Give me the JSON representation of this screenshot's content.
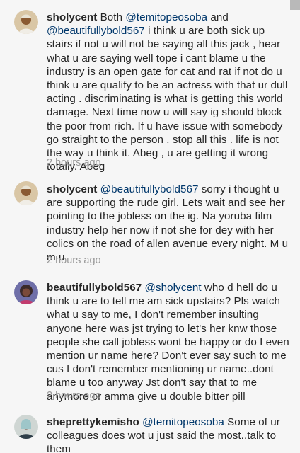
{
  "comments": [
    {
      "username": "sholycent",
      "avatar": "avatar-sholycent",
      "parts": [
        {
          "type": "text",
          "value": " Both "
        },
        {
          "type": "mention",
          "value": "@temitopeosoba"
        },
        {
          "type": "text",
          "value": "  and "
        },
        {
          "type": "mention",
          "value": "@beautifullybold567"
        },
        {
          "type": "text",
          "value": " i think u are both sick up stairs if not u will not be saying all this jack , hear what u are saying well tope i cant blame u the industry is an open gate for cat and rat if not do u think u are qualify to be an actress with that ur dull acting . discriminating is what is getting this world damage.  Next time now u will say ig should block the poor from rich. If u have issue with somebody go straight to the person . stop all this . life is not the way u think it. Abeg , u are getting it wrong totally. Abeg"
        }
      ],
      "time": "2 hours ago"
    },
    {
      "username": "sholycent",
      "avatar": "avatar-sholycent",
      "parts": [
        {
          "type": "text",
          "value": " "
        },
        {
          "type": "mention",
          "value": "@beautifullybold567"
        },
        {
          "type": "text",
          "value": " sorry i thought u are supporting the rude girl. Lets wait and see her pointing to the jobless on the ig. Na yoruba film industry help her now if not she for dey with her colics on the road of allen avenue every night. M u m u"
        }
      ],
      "time": "2 hours ago"
    },
    {
      "username": "beautifullybold567",
      "avatar": "avatar-beautifullybold567",
      "parts": [
        {
          "type": "text",
          "value": " "
        },
        {
          "type": "mention",
          "value": "@sholycent"
        },
        {
          "type": "text",
          "value": " who d hell do u think u are to tell me am sick upstairs? Pls watch what u say to me, I don't remember insulting anyone here was jst trying to let's her knw those people she call jobless wont be happy or do I even mention ur name here? Don't ever say such to me cus I don't remember mentioning ur name..dont blame u too anyway Jst don't say that to me anymore or amma give u double bitter pill"
        }
      ],
      "time": "2 hours ago"
    },
    {
      "username": "sheprettykemisho",
      "avatar": "avatar-sheprettykemisho",
      "parts": [
        {
          "type": "text",
          "value": " "
        },
        {
          "type": "mention",
          "value": "@temitopeosoba"
        },
        {
          "type": "text",
          "value": " Some of ur colleagues does wot u just said the most..talk to them"
        }
      ],
      "time": ""
    }
  ],
  "colors": {
    "background": "#f6f6f6",
    "text": "#262626",
    "mention": "#00376b",
    "timestamp": "#999999"
  }
}
